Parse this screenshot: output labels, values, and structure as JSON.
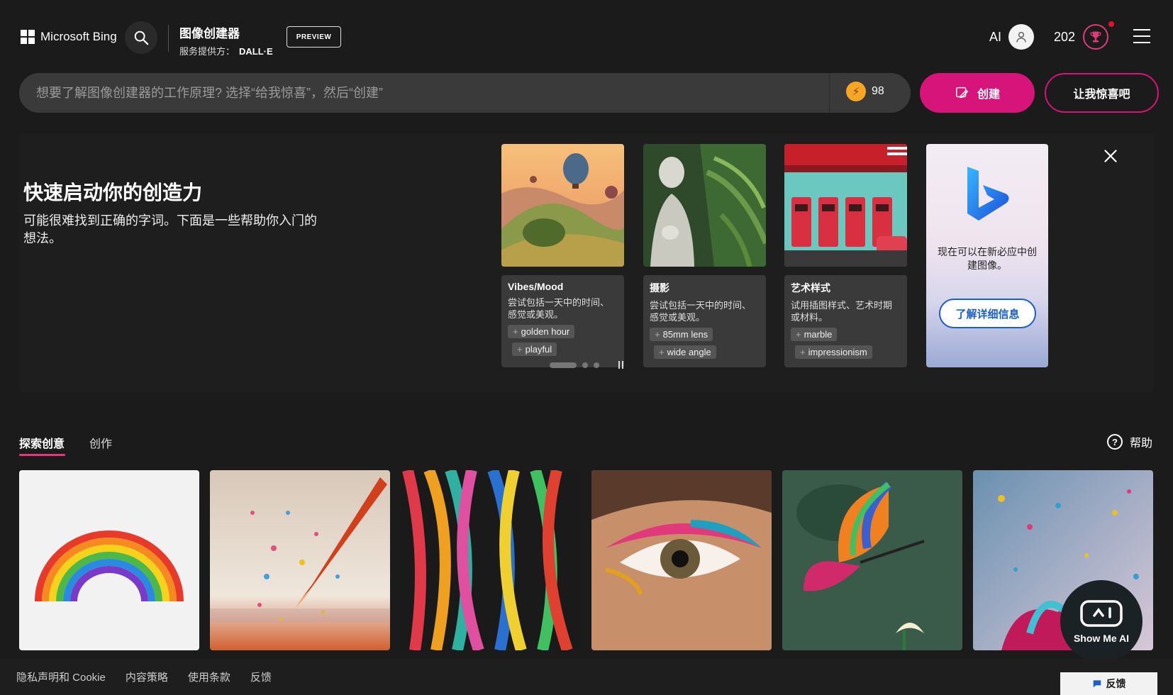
{
  "header": {
    "logo_text": "Microsoft Bing",
    "app_title": "图像创建器",
    "provider_label": "服务提供方：",
    "provider_name": "DALL·E",
    "preview_badge": "PREVIEW",
    "ai_label": "AI",
    "rewards_count": "202"
  },
  "prompt": {
    "placeholder": "想要了解图像创建器的工作原理? 选择“给我惊喜”，然后“创建”",
    "boost_count": "98",
    "create_label": "创建",
    "surprise_label": "让我惊喜吧"
  },
  "quickstart": {
    "title": "快速启动你的创造力",
    "description": "可能很难找到正确的字词。下面是一些帮助你入门的想法。",
    "cards": [
      {
        "title": "Vibes/Mood",
        "description": "尝试包括一天中的时间、感觉或美观。",
        "chips": [
          "golden hour",
          "playful"
        ]
      },
      {
        "title": "摄影",
        "description": "尝试包括一天中的时间、感觉或美观。",
        "chips": [
          "85mm lens",
          "wide angle"
        ]
      },
      {
        "title": "艺术样式",
        "description": "试用插图样式、艺术时期或材料。",
        "chips": [
          "marble",
          "impressionism"
        ]
      }
    ],
    "promo": {
      "text": "现在可以在新必应中创建图像。",
      "button_label": "了解详细信息"
    }
  },
  "tabs": {
    "explore": "探索创意",
    "create": "创作",
    "help": "帮助"
  },
  "footer": {
    "links": [
      "隐私声明和 Cookie",
      "内容策略",
      "使用条款",
      "反馈"
    ],
    "feedback_button": "反馈"
  },
  "showme": {
    "label": "Show Me AI"
  },
  "colors": {
    "accent": "#d6147a",
    "background": "#1b1b1b",
    "link_blue": "#1a5fcf"
  }
}
